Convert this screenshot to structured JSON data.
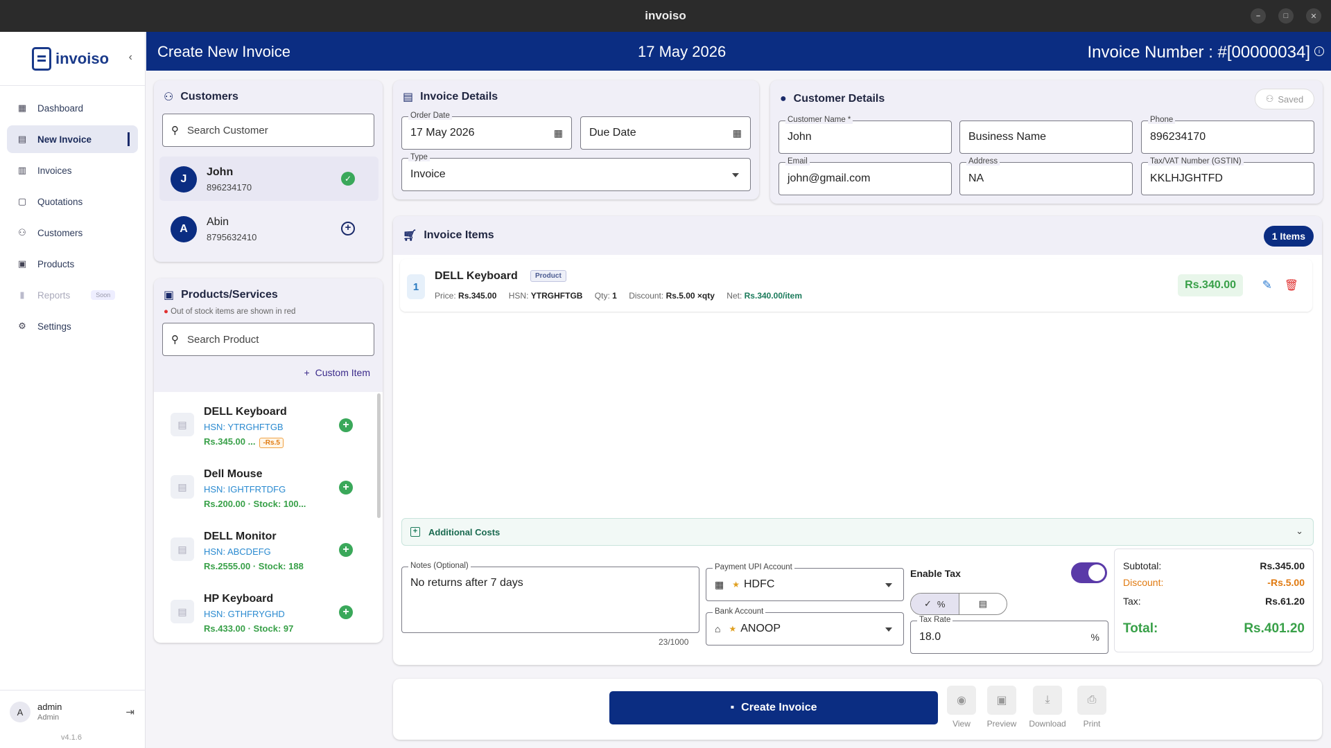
{
  "window": {
    "title": "invoiso"
  },
  "sidebar": {
    "brand": "invoiso",
    "items": [
      {
        "label": "Dashboard",
        "icon": "dashboard-icon"
      },
      {
        "label": "New Invoice",
        "icon": "invoice-icon"
      },
      {
        "label": "Invoices",
        "icon": "receipt-icon"
      },
      {
        "label": "Quotations",
        "icon": "quote-icon"
      },
      {
        "label": "Customers",
        "icon": "people-icon"
      },
      {
        "label": "Products",
        "icon": "box-icon"
      },
      {
        "label": "Reports",
        "icon": "bar-chart-icon",
        "badge": "Soon"
      },
      {
        "label": "Settings",
        "icon": "gear-icon"
      }
    ],
    "user": {
      "initial": "A",
      "name": "admin",
      "role": "Admin"
    },
    "version": "v4.1.6"
  },
  "header": {
    "title": "Create New Invoice",
    "date": "17 May 2026",
    "invoice_number": "Invoice Number : #[00000034]"
  },
  "customers": {
    "title": "Customers",
    "search_placeholder": "Search Customer",
    "list": [
      {
        "initial": "J",
        "name": "John",
        "phone": "896234170",
        "selected": true
      },
      {
        "initial": "A",
        "name": "Abin",
        "phone": "8795632410",
        "selected": false
      }
    ]
  },
  "products": {
    "title": "Products/Services",
    "note": "Out of stock items are shown in red",
    "search_placeholder": "Search Product",
    "custom_item": "Custom Item",
    "list": [
      {
        "name": "DELL Keyboard",
        "hsn": "HSN: YTRGHFTGB",
        "price": "Rs.345.00 ...",
        "discount": "-Rs.5"
      },
      {
        "name": "Dell Mouse",
        "hsn": "HSN: IGHTFRTDFG",
        "price": "Rs.200.00  ·  Stock: 100..."
      },
      {
        "name": "DELL Monitor",
        "hsn": "HSN: ABCDEFG",
        "price": "Rs.2555.00  ·  Stock: 188"
      },
      {
        "name": "HP Keyboard",
        "hsn": "HSN: GTHFRYGHD",
        "price": "Rs.433.00  ·  Stock: 97"
      }
    ]
  },
  "invoice_details": {
    "title": "Invoice Details",
    "order_date_label": "Order Date",
    "order_date": "17 May 2026",
    "due_date_placeholder": "Due Date",
    "type_label": "Type",
    "type": "Invoice"
  },
  "customer_details": {
    "title": "Customer Details",
    "saved": "Saved",
    "fields": {
      "name_label": "Customer Name *",
      "name": "John",
      "business_placeholder": "Business Name",
      "phone_label": "Phone",
      "phone": "896234170",
      "email_label": "Email",
      "email": "john@gmail.com",
      "address_label": "Address",
      "address": "NA",
      "tax_label": "Tax/VAT Number (GSTIN)",
      "tax": "KKLHJGHTFD"
    }
  },
  "invoice_items": {
    "title": "Invoice Items",
    "count_badge": "1 Items",
    "items": [
      {
        "index": "1",
        "name": "DELL Keyboard",
        "tag": "Product",
        "price_label": "Price:",
        "price": "Rs.345.00",
        "hsn_label": "HSN:",
        "hsn": "YTRGHFTGB",
        "qty_label": "Qty:",
        "qty": "1",
        "discount_label": "Discount:",
        "discount": "Rs.5.00 ×qty",
        "net_label": "Net:",
        "net": "Rs.340.00/item",
        "total": "Rs.340.00"
      }
    ],
    "additional_costs": "Additional Costs"
  },
  "notes": {
    "label": "Notes (Optional)",
    "value": "No returns after 7 days",
    "counter": "23/1000"
  },
  "payment": {
    "upi_label": "Payment UPI Account",
    "upi": "HDFC",
    "bank_label": "Bank Account",
    "bank": "ANOOP"
  },
  "tax": {
    "enable_label": "Enable Tax",
    "enabled": true,
    "mode_percent": "%",
    "rate_label": "Tax Rate",
    "rate": "18.0",
    "unit": "%"
  },
  "summary": {
    "subtotal_label": "Subtotal:",
    "subtotal": "Rs.345.00",
    "discount_label": "Discount:",
    "discount": "-Rs.5.00",
    "tax_label": "Tax:",
    "tax": "Rs.61.20",
    "total_label": "Total:",
    "total": "Rs.401.20"
  },
  "actions": {
    "create": "Create Invoice",
    "view": "View",
    "preview": "Preview",
    "download": "Download",
    "print": "Print"
  },
  "colors": {
    "brand": "#0b2d82",
    "success": "#38a048",
    "danger": "#e03030",
    "accent": "#5a3aa8",
    "discount": "#e07a10"
  }
}
